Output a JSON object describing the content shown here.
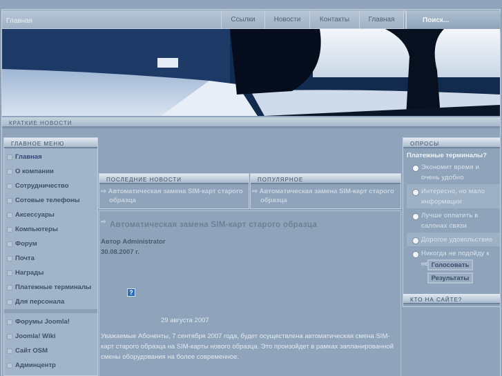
{
  "topnav": {
    "home": "Главная",
    "items": [
      "Ссылки",
      "Новости",
      "Контакты",
      "Главная"
    ],
    "search": "Поиск..."
  },
  "short_news": "КРАТКИЕ НОВОСТИ",
  "main_menu": {
    "title": "ГЛАВНОЕ МЕНЮ",
    "items": [
      "Главная",
      "О компании",
      "Сотрудничество",
      "Сотовые телефоны",
      "Аксессуары",
      "Компьютеры",
      "Форум",
      "Почта",
      "Награды",
      "Платежные терминалы",
      "Для персонала"
    ],
    "items2": [
      "Форумы Joomla!",
      "Joomla! Wiki",
      "Сайт OSM",
      "Админцентр"
    ]
  },
  "latest": {
    "title": "ПОСЛЕДНИЕ НОВОСТИ",
    "item": "Автоматическая замена SIM-карт старого образца"
  },
  "popular": {
    "title": "ПОПУЛЯРНОЕ",
    "item": "Автоматическая замена SIM-карт старого образца"
  },
  "article": {
    "title": "Автоматическая замена SIM-карт старого образца",
    "author": "Автор Administrator",
    "date": "30.08.2007 г.",
    "icon": "?",
    "dateline": "29 августа 2007",
    "body": "Уважаемые Абоненты, 7 сентября 2007 года, будет осуществлена автоматическая смена SIM-карт старого образца на SIM-карты нового образца. Это произойдет в рамках запланированной смены оборудования на более современное."
  },
  "poll": {
    "title": "ОПРОСЫ",
    "question": "Платежные терминалы?",
    "options": [
      "Экономит время и очень удобно",
      "Интересно, но мало информации",
      "Лучше оплатить в салонах связи",
      "Дорогое удовольствие",
      "Никогда не подойду к нему"
    ],
    "vote": "Голосовать",
    "results": "Результаты"
  },
  "who_online": {
    "title": "КТО НА САЙТЕ?"
  }
}
